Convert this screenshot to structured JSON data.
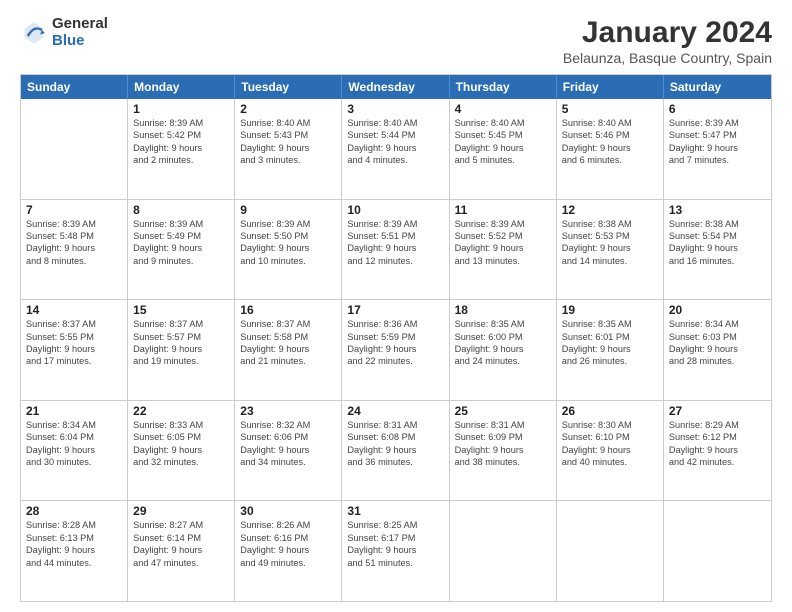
{
  "header": {
    "logo_general": "General",
    "logo_blue": "Blue",
    "main_title": "January 2024",
    "subtitle": "Belaunza, Basque Country, Spain"
  },
  "weekdays": [
    "Sunday",
    "Monday",
    "Tuesday",
    "Wednesday",
    "Thursday",
    "Friday",
    "Saturday"
  ],
  "weeks": [
    [
      {
        "day": "",
        "lines": []
      },
      {
        "day": "1",
        "lines": [
          "Sunrise: 8:39 AM",
          "Sunset: 5:42 PM",
          "Daylight: 9 hours",
          "and 2 minutes."
        ]
      },
      {
        "day": "2",
        "lines": [
          "Sunrise: 8:40 AM",
          "Sunset: 5:43 PM",
          "Daylight: 9 hours",
          "and 3 minutes."
        ]
      },
      {
        "day": "3",
        "lines": [
          "Sunrise: 8:40 AM",
          "Sunset: 5:44 PM",
          "Daylight: 9 hours",
          "and 4 minutes."
        ]
      },
      {
        "day": "4",
        "lines": [
          "Sunrise: 8:40 AM",
          "Sunset: 5:45 PM",
          "Daylight: 9 hours",
          "and 5 minutes."
        ]
      },
      {
        "day": "5",
        "lines": [
          "Sunrise: 8:40 AM",
          "Sunset: 5:46 PM",
          "Daylight: 9 hours",
          "and 6 minutes."
        ]
      },
      {
        "day": "6",
        "lines": [
          "Sunrise: 8:39 AM",
          "Sunset: 5:47 PM",
          "Daylight: 9 hours",
          "and 7 minutes."
        ]
      }
    ],
    [
      {
        "day": "7",
        "lines": [
          "Sunrise: 8:39 AM",
          "Sunset: 5:48 PM",
          "Daylight: 9 hours",
          "and 8 minutes."
        ]
      },
      {
        "day": "8",
        "lines": [
          "Sunrise: 8:39 AM",
          "Sunset: 5:49 PM",
          "Daylight: 9 hours",
          "and 9 minutes."
        ]
      },
      {
        "day": "9",
        "lines": [
          "Sunrise: 8:39 AM",
          "Sunset: 5:50 PM",
          "Daylight: 9 hours",
          "and 10 minutes."
        ]
      },
      {
        "day": "10",
        "lines": [
          "Sunrise: 8:39 AM",
          "Sunset: 5:51 PM",
          "Daylight: 9 hours",
          "and 12 minutes."
        ]
      },
      {
        "day": "11",
        "lines": [
          "Sunrise: 8:39 AM",
          "Sunset: 5:52 PM",
          "Daylight: 9 hours",
          "and 13 minutes."
        ]
      },
      {
        "day": "12",
        "lines": [
          "Sunrise: 8:38 AM",
          "Sunset: 5:53 PM",
          "Daylight: 9 hours",
          "and 14 minutes."
        ]
      },
      {
        "day": "13",
        "lines": [
          "Sunrise: 8:38 AM",
          "Sunset: 5:54 PM",
          "Daylight: 9 hours",
          "and 16 minutes."
        ]
      }
    ],
    [
      {
        "day": "14",
        "lines": [
          "Sunrise: 8:37 AM",
          "Sunset: 5:55 PM",
          "Daylight: 9 hours",
          "and 17 minutes."
        ]
      },
      {
        "day": "15",
        "lines": [
          "Sunrise: 8:37 AM",
          "Sunset: 5:57 PM",
          "Daylight: 9 hours",
          "and 19 minutes."
        ]
      },
      {
        "day": "16",
        "lines": [
          "Sunrise: 8:37 AM",
          "Sunset: 5:58 PM",
          "Daylight: 9 hours",
          "and 21 minutes."
        ]
      },
      {
        "day": "17",
        "lines": [
          "Sunrise: 8:36 AM",
          "Sunset: 5:59 PM",
          "Daylight: 9 hours",
          "and 22 minutes."
        ]
      },
      {
        "day": "18",
        "lines": [
          "Sunrise: 8:35 AM",
          "Sunset: 6:00 PM",
          "Daylight: 9 hours",
          "and 24 minutes."
        ]
      },
      {
        "day": "19",
        "lines": [
          "Sunrise: 8:35 AM",
          "Sunset: 6:01 PM",
          "Daylight: 9 hours",
          "and 26 minutes."
        ]
      },
      {
        "day": "20",
        "lines": [
          "Sunrise: 8:34 AM",
          "Sunset: 6:03 PM",
          "Daylight: 9 hours",
          "and 28 minutes."
        ]
      }
    ],
    [
      {
        "day": "21",
        "lines": [
          "Sunrise: 8:34 AM",
          "Sunset: 6:04 PM",
          "Daylight: 9 hours",
          "and 30 minutes."
        ]
      },
      {
        "day": "22",
        "lines": [
          "Sunrise: 8:33 AM",
          "Sunset: 6:05 PM",
          "Daylight: 9 hours",
          "and 32 minutes."
        ]
      },
      {
        "day": "23",
        "lines": [
          "Sunrise: 8:32 AM",
          "Sunset: 6:06 PM",
          "Daylight: 9 hours",
          "and 34 minutes."
        ]
      },
      {
        "day": "24",
        "lines": [
          "Sunrise: 8:31 AM",
          "Sunset: 6:08 PM",
          "Daylight: 9 hours",
          "and 36 minutes."
        ]
      },
      {
        "day": "25",
        "lines": [
          "Sunrise: 8:31 AM",
          "Sunset: 6:09 PM",
          "Daylight: 9 hours",
          "and 38 minutes."
        ]
      },
      {
        "day": "26",
        "lines": [
          "Sunrise: 8:30 AM",
          "Sunset: 6:10 PM",
          "Daylight: 9 hours",
          "and 40 minutes."
        ]
      },
      {
        "day": "27",
        "lines": [
          "Sunrise: 8:29 AM",
          "Sunset: 6:12 PM",
          "Daylight: 9 hours",
          "and 42 minutes."
        ]
      }
    ],
    [
      {
        "day": "28",
        "lines": [
          "Sunrise: 8:28 AM",
          "Sunset: 6:13 PM",
          "Daylight: 9 hours",
          "and 44 minutes."
        ]
      },
      {
        "day": "29",
        "lines": [
          "Sunrise: 8:27 AM",
          "Sunset: 6:14 PM",
          "Daylight: 9 hours",
          "and 47 minutes."
        ]
      },
      {
        "day": "30",
        "lines": [
          "Sunrise: 8:26 AM",
          "Sunset: 6:16 PM",
          "Daylight: 9 hours",
          "and 49 minutes."
        ]
      },
      {
        "day": "31",
        "lines": [
          "Sunrise: 8:25 AM",
          "Sunset: 6:17 PM",
          "Daylight: 9 hours",
          "and 51 minutes."
        ]
      },
      {
        "day": "",
        "lines": []
      },
      {
        "day": "",
        "lines": []
      },
      {
        "day": "",
        "lines": []
      }
    ]
  ]
}
